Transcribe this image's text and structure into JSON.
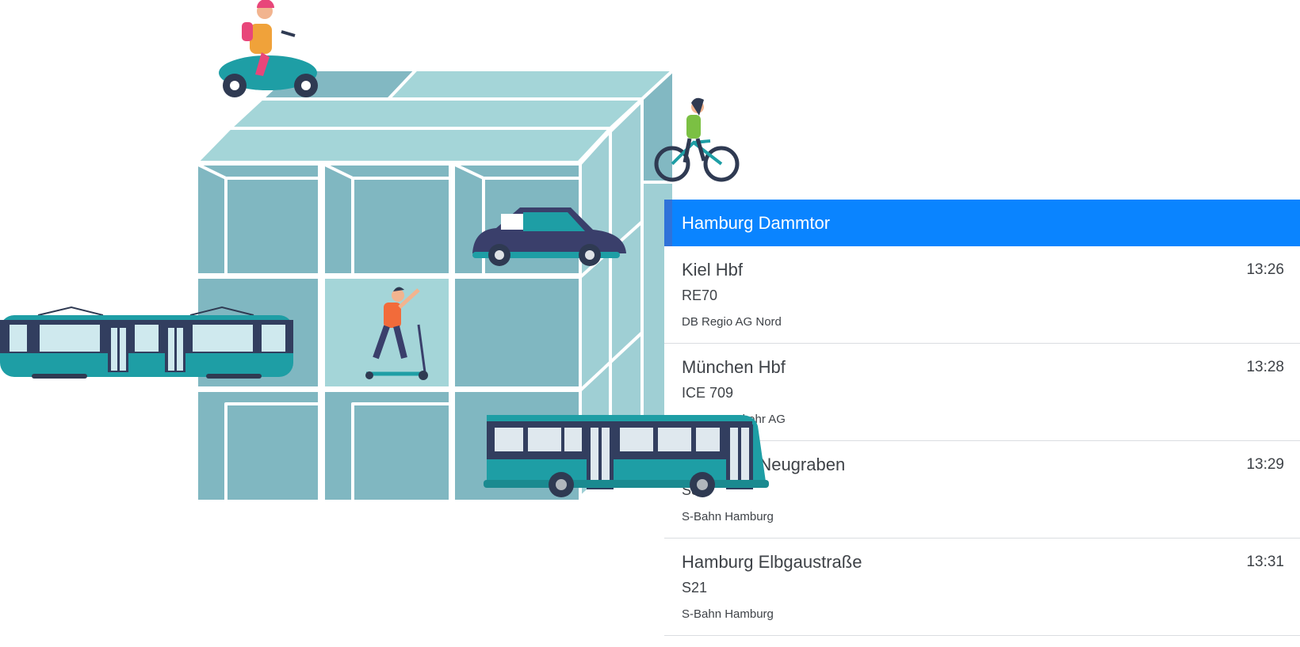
{
  "colors": {
    "header_bg": "#0a84ff",
    "header_text": "#ffffff",
    "cube_face": "#80b7c1",
    "cube_top": "#a4d5d8",
    "vehicle_teal": "#1e9ea5",
    "vehicle_navy": "#323e5f"
  },
  "illustration": {
    "icons": [
      "cube-grid-icon",
      "scooter-rider-icon",
      "cyclist-icon",
      "car-icon",
      "kick-scooter-icon",
      "tram-icon",
      "bus-icon"
    ]
  },
  "station": {
    "name": "Hamburg Dammtor"
  },
  "departures": [
    {
      "destination": "Kiel Hbf",
      "time": "13:26",
      "line": "RE70",
      "operator": "DB Regio AG Nord"
    },
    {
      "destination": "München Hbf",
      "time": "13:28",
      "line": "ICE 709",
      "operator": "DB Fernverkehr AG"
    },
    {
      "destination": "-Neugraben",
      "time": "13:29",
      "line": "S31",
      "operator": "S-Bahn Hamburg"
    },
    {
      "destination": "Hamburg Elbgaustraße",
      "time": "13:31",
      "line": "S21",
      "operator": "S-Bahn Hamburg"
    }
  ]
}
